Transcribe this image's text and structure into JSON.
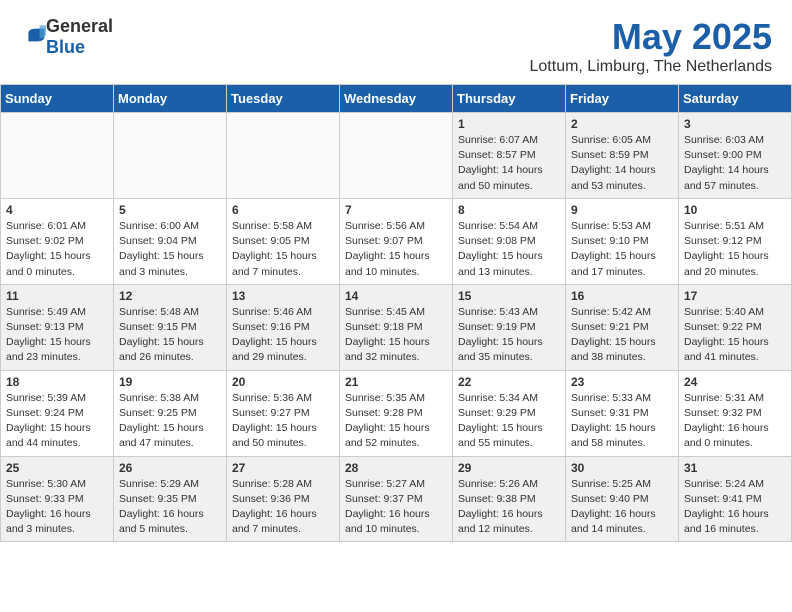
{
  "header": {
    "logo_general": "General",
    "logo_blue": "Blue",
    "month_year": "May 2025",
    "location": "Lottum, Limburg, The Netherlands"
  },
  "days_of_week": [
    "Sunday",
    "Monday",
    "Tuesday",
    "Wednesday",
    "Thursday",
    "Friday",
    "Saturday"
  ],
  "weeks": [
    [
      {
        "day": "",
        "empty": true
      },
      {
        "day": "",
        "empty": true
      },
      {
        "day": "",
        "empty": true
      },
      {
        "day": "",
        "empty": true
      },
      {
        "day": "1",
        "sunrise": "6:07 AM",
        "sunset": "8:57 PM",
        "daylight": "14 hours and 50 minutes."
      },
      {
        "day": "2",
        "sunrise": "6:05 AM",
        "sunset": "8:59 PM",
        "daylight": "14 hours and 53 minutes."
      },
      {
        "day": "3",
        "sunrise": "6:03 AM",
        "sunset": "9:00 PM",
        "daylight": "14 hours and 57 minutes."
      }
    ],
    [
      {
        "day": "4",
        "sunrise": "6:01 AM",
        "sunset": "9:02 PM",
        "daylight": "15 hours and 0 minutes."
      },
      {
        "day": "5",
        "sunrise": "6:00 AM",
        "sunset": "9:04 PM",
        "daylight": "15 hours and 3 minutes."
      },
      {
        "day": "6",
        "sunrise": "5:58 AM",
        "sunset": "9:05 PM",
        "daylight": "15 hours and 7 minutes."
      },
      {
        "day": "7",
        "sunrise": "5:56 AM",
        "sunset": "9:07 PM",
        "daylight": "15 hours and 10 minutes."
      },
      {
        "day": "8",
        "sunrise": "5:54 AM",
        "sunset": "9:08 PM",
        "daylight": "15 hours and 13 minutes."
      },
      {
        "day": "9",
        "sunrise": "5:53 AM",
        "sunset": "9:10 PM",
        "daylight": "15 hours and 17 minutes."
      },
      {
        "day": "10",
        "sunrise": "5:51 AM",
        "sunset": "9:12 PM",
        "daylight": "15 hours and 20 minutes."
      }
    ],
    [
      {
        "day": "11",
        "sunrise": "5:49 AM",
        "sunset": "9:13 PM",
        "daylight": "15 hours and 23 minutes."
      },
      {
        "day": "12",
        "sunrise": "5:48 AM",
        "sunset": "9:15 PM",
        "daylight": "15 hours and 26 minutes."
      },
      {
        "day": "13",
        "sunrise": "5:46 AM",
        "sunset": "9:16 PM",
        "daylight": "15 hours and 29 minutes."
      },
      {
        "day": "14",
        "sunrise": "5:45 AM",
        "sunset": "9:18 PM",
        "daylight": "15 hours and 32 minutes."
      },
      {
        "day": "15",
        "sunrise": "5:43 AM",
        "sunset": "9:19 PM",
        "daylight": "15 hours and 35 minutes."
      },
      {
        "day": "16",
        "sunrise": "5:42 AM",
        "sunset": "9:21 PM",
        "daylight": "15 hours and 38 minutes."
      },
      {
        "day": "17",
        "sunrise": "5:40 AM",
        "sunset": "9:22 PM",
        "daylight": "15 hours and 41 minutes."
      }
    ],
    [
      {
        "day": "18",
        "sunrise": "5:39 AM",
        "sunset": "9:24 PM",
        "daylight": "15 hours and 44 minutes."
      },
      {
        "day": "19",
        "sunrise": "5:38 AM",
        "sunset": "9:25 PM",
        "daylight": "15 hours and 47 minutes."
      },
      {
        "day": "20",
        "sunrise": "5:36 AM",
        "sunset": "9:27 PM",
        "daylight": "15 hours and 50 minutes."
      },
      {
        "day": "21",
        "sunrise": "5:35 AM",
        "sunset": "9:28 PM",
        "daylight": "15 hours and 52 minutes."
      },
      {
        "day": "22",
        "sunrise": "5:34 AM",
        "sunset": "9:29 PM",
        "daylight": "15 hours and 55 minutes."
      },
      {
        "day": "23",
        "sunrise": "5:33 AM",
        "sunset": "9:31 PM",
        "daylight": "15 hours and 58 minutes."
      },
      {
        "day": "24",
        "sunrise": "5:31 AM",
        "sunset": "9:32 PM",
        "daylight": "16 hours and 0 minutes."
      }
    ],
    [
      {
        "day": "25",
        "sunrise": "5:30 AM",
        "sunset": "9:33 PM",
        "daylight": "16 hours and 3 minutes."
      },
      {
        "day": "26",
        "sunrise": "5:29 AM",
        "sunset": "9:35 PM",
        "daylight": "16 hours and 5 minutes."
      },
      {
        "day": "27",
        "sunrise": "5:28 AM",
        "sunset": "9:36 PM",
        "daylight": "16 hours and 7 minutes."
      },
      {
        "day": "28",
        "sunrise": "5:27 AM",
        "sunset": "9:37 PM",
        "daylight": "16 hours and 10 minutes."
      },
      {
        "day": "29",
        "sunrise": "5:26 AM",
        "sunset": "9:38 PM",
        "daylight": "16 hours and 12 minutes."
      },
      {
        "day": "30",
        "sunrise": "5:25 AM",
        "sunset": "9:40 PM",
        "daylight": "16 hours and 14 minutes."
      },
      {
        "day": "31",
        "sunrise": "5:24 AM",
        "sunset": "9:41 PM",
        "daylight": "16 hours and 16 minutes."
      }
    ]
  ],
  "labels": {
    "sunrise": "Sunrise:",
    "sunset": "Sunset:",
    "daylight": "Daylight:"
  }
}
